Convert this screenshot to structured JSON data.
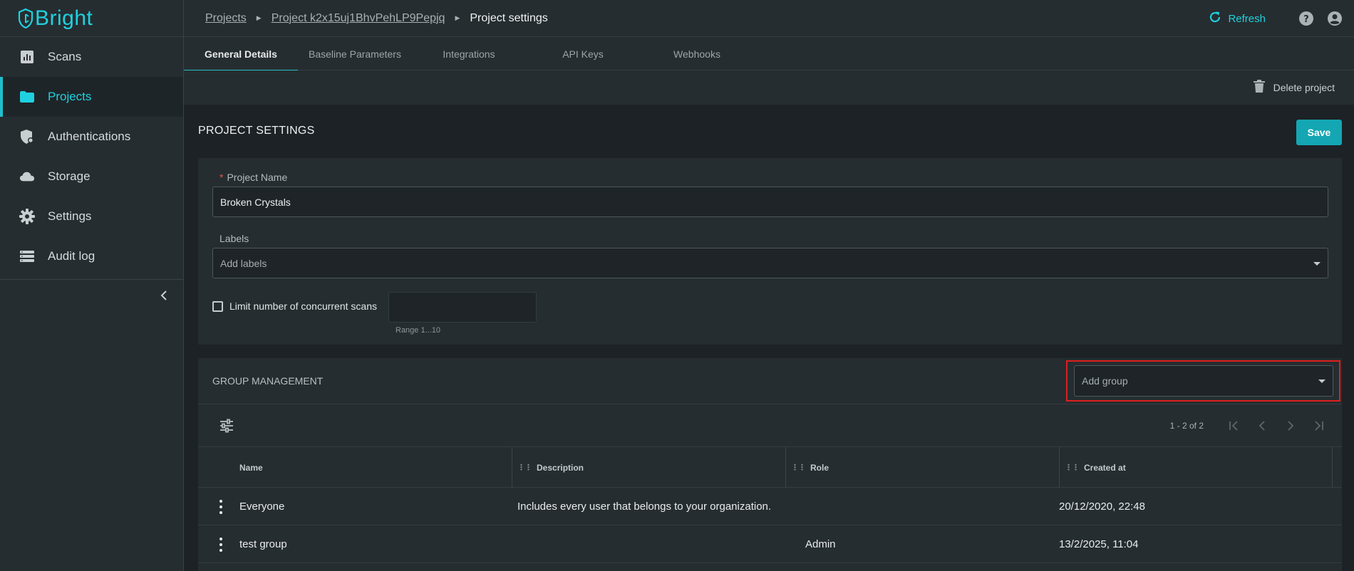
{
  "app": {
    "logo_text": "Bright",
    "accent_color": "#1fd1e0",
    "primary_button_color": "#14a6b3",
    "highlight_color": "#e01e1e"
  },
  "sidebar": {
    "items": [
      {
        "label": "Scans",
        "icon": "bar-chart-icon"
      },
      {
        "label": "Projects",
        "icon": "folder-icon",
        "active": true
      },
      {
        "label": "Authentications",
        "icon": "shield-icon"
      },
      {
        "label": "Storage",
        "icon": "cloud-icon"
      },
      {
        "label": "Settings",
        "icon": "gear-icon"
      },
      {
        "label": "Audit log",
        "icon": "list-icon"
      }
    ]
  },
  "breadcrumb": {
    "items": [
      "Projects",
      "Project k2x15uj1BhvPehLP9Pepjq"
    ],
    "current": "Project settings"
  },
  "header": {
    "refresh_label": "Refresh"
  },
  "tabs": [
    "General Details",
    "Baseline Parameters",
    "Integrations",
    "API Keys",
    "Webhooks"
  ],
  "actions": {
    "delete_label": "Delete project"
  },
  "settings": {
    "title": "PROJECT SETTINGS",
    "save_label": "Save",
    "project_name_label": "Project Name",
    "project_name_value": "Broken Crystals",
    "labels_label": "Labels",
    "labels_placeholder": "Add labels",
    "limit_label": "Limit number of concurrent scans",
    "limit_value": "",
    "range_hint": "Range 1...10"
  },
  "group_management": {
    "title": "GROUP MANAGEMENT",
    "add_group_placeholder": "Add group",
    "pager_text": "1 - 2 of 2",
    "columns": [
      "Name",
      "Description",
      "Role",
      "Created at"
    ],
    "rows": [
      {
        "name": "Everyone",
        "description": "Includes every user that belongs to your organization.",
        "role": "",
        "created_at": "20/12/2020, 22:48"
      },
      {
        "name": "test group",
        "description": "",
        "role": "Admin",
        "created_at": "13/2/2025, 11:04"
      }
    ]
  }
}
